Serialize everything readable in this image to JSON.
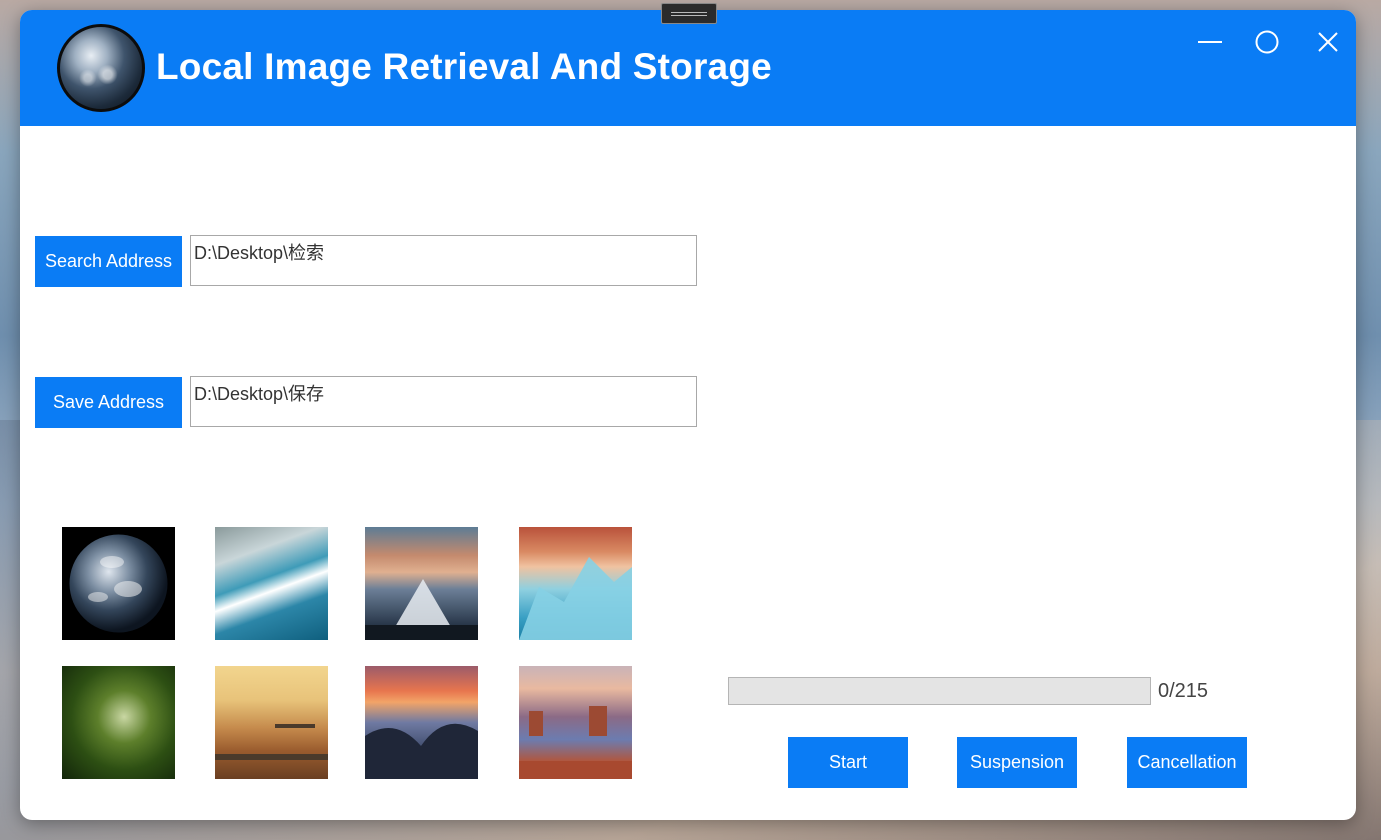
{
  "app": {
    "title": "Local Image Retrieval And Storage",
    "accent_color": "#0a7cf5",
    "logo_icon": "earth-globe-icon"
  },
  "window_controls": {
    "minimize_icon": "minimize-icon",
    "maximize_icon": "maximize-icon",
    "close_icon": "close-icon"
  },
  "search": {
    "button_label": "Search Address",
    "path_value": "D:\\Desktop\\检索"
  },
  "save": {
    "button_label": "Save Address",
    "path_value": "D:\\Desktop\\保存"
  },
  "thumbnails": [
    {
      "name": "earth-from-space"
    },
    {
      "name": "ocean-waves-aerial"
    },
    {
      "name": "volcano-with-clouds"
    },
    {
      "name": "icy-mountains-sunset"
    },
    {
      "name": "forest-path"
    },
    {
      "name": "bridges-city-sunset"
    },
    {
      "name": "mountain-valley-sunset"
    },
    {
      "name": "canyon-rock-formations"
    }
  ],
  "progress": {
    "current": 0,
    "total": 215,
    "text": "0/215"
  },
  "actions": {
    "start_label": "Start",
    "suspension_label": "Suspension",
    "cancellation_label": "Cancellation"
  }
}
